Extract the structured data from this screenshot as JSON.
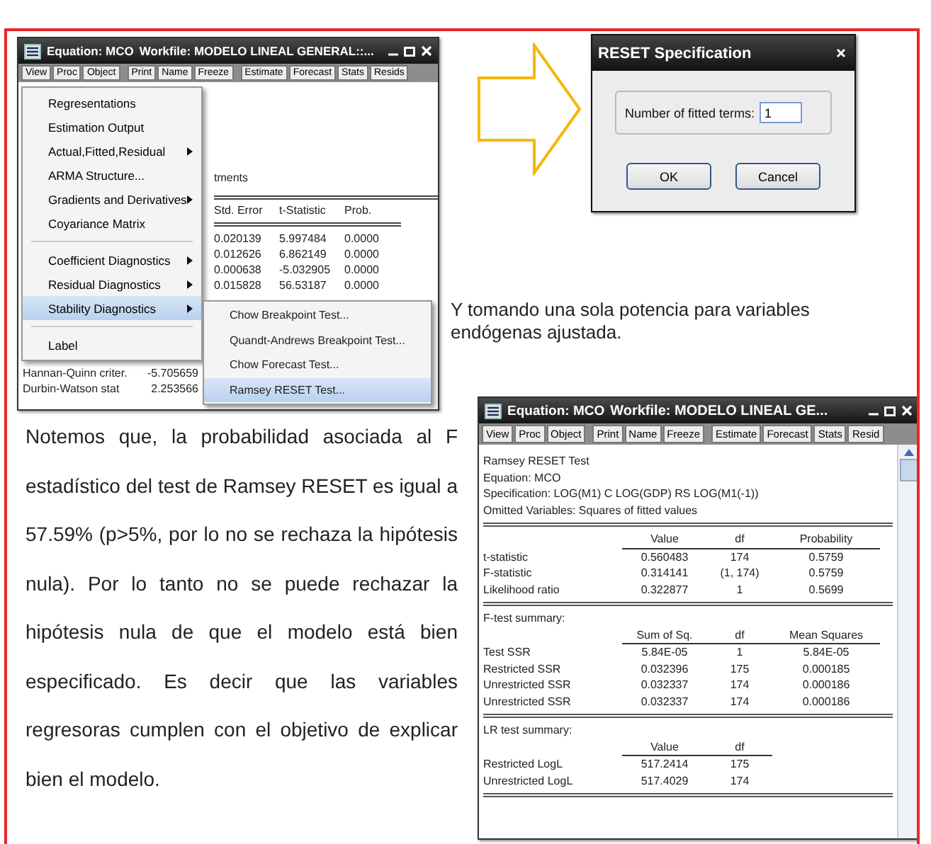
{
  "equation_window": {
    "title": "Equation: MCO",
    "workfile": "Workfile: MODELO LINEAL GENERAL::...",
    "toolbar": [
      "View",
      "Proc",
      "Object",
      "Print",
      "Name",
      "Freeze",
      "Estimate",
      "Forecast",
      "Stats",
      "Resids"
    ],
    "partial_label": "tments",
    "columns": [
      "Std. Error",
      "t-Statistic",
      "Prob."
    ],
    "rows": [
      [
        "0.020139",
        "5.997484",
        "0.0000"
      ],
      [
        "0.012626",
        "6.862149",
        "0.0000"
      ],
      [
        "0.000638",
        "-5.032905",
        "0.0000"
      ],
      [
        "0.015828",
        "56.53187",
        "0.0000"
      ]
    ],
    "stats": [
      {
        "label": "Hannan-Quinn criter.",
        "value": "-5.705659"
      },
      {
        "label": "Durbin-Watson stat",
        "value": "2.253566"
      }
    ],
    "menu": [
      {
        "kind": "item",
        "label": "Regresentations",
        "submenu": false,
        "selected": false
      },
      {
        "kind": "item",
        "label": "Estimation Output",
        "submenu": false,
        "selected": false
      },
      {
        "kind": "item",
        "label": "Actual,Fitted,Residual",
        "submenu": true,
        "selected": false
      },
      {
        "kind": "item",
        "label": "ARMA Structure...",
        "submenu": false,
        "selected": false
      },
      {
        "kind": "item",
        "label": "Gradients and Derivatives",
        "submenu": true,
        "selected": false
      },
      {
        "kind": "item",
        "label": "Coyariance Matrix",
        "submenu": false,
        "selected": false
      },
      {
        "kind": "separator"
      },
      {
        "kind": "item",
        "label": "Coefficient Diagnostics",
        "submenu": true,
        "selected": false
      },
      {
        "kind": "item",
        "label": "Residual Diagnostics",
        "submenu": true,
        "selected": false
      },
      {
        "kind": "item",
        "label": "Stability Diagnostics",
        "submenu": true,
        "selected": true
      },
      {
        "kind": "separator"
      },
      {
        "kind": "item",
        "label": "Label",
        "submenu": false,
        "selected": false
      }
    ],
    "submenu": [
      {
        "label": "Chow Breakpoint Test...",
        "selected": false
      },
      {
        "label": "Quandt-Andrews Breakpoint Test...",
        "selected": false
      },
      {
        "label": "Chow Forecast Test...",
        "selected": false
      },
      {
        "label": "Ramsey RESET Test...",
        "selected": true
      }
    ]
  },
  "dialog": {
    "title": "RESET Specification",
    "field_label": "Number of fitted terms:",
    "field_value": "1",
    "buttons": [
      "OK",
      "Cancel"
    ]
  },
  "caption": "Y tomando una sola potencia para variables endógenas ajustada.",
  "paragraph": "Notemos que, la probabilidad asociada al F estadístico del test de Ramsey RESET es igual a 57.59% (p>5%, por lo no se rechaza la hipótesis nula). Por lo tanto no se puede rechazar la hipótesis nula de que el modelo está bien especificado. Es decir que las variables regresoras cumplen con el objetivo de explicar bien el modelo.",
  "result_window": {
    "title": "Equation: MCO",
    "workfile": "Workfile: MODELO LINEAL GE...",
    "toolbar": [
      "View",
      "Proc",
      "Object",
      "Print",
      "Name",
      "Freeze",
      "Estimate",
      "Forecast",
      "Stats",
      "Resid"
    ],
    "header": [
      "Ramsey RESET Test",
      "Equation: MCO",
      "Specification: LOG(M1) C LOG(GDP) RS LOG(M1(-1))",
      "Omitted Variables: Squares of fitted values"
    ],
    "sections": [
      {
        "columns": [
          "Value",
          "df",
          "Probability"
        ],
        "rows": [
          {
            "label": "t-statistic",
            "cells": [
              "0.560483",
              "174",
              "0.5759"
            ]
          },
          {
            "label": "F-statistic",
            "cells": [
              "0.314141",
              "(1, 174)",
              "0.5759"
            ]
          },
          {
            "label": "Likelihood ratio",
            "cells": [
              "0.322877",
              "1",
              "0.5699"
            ]
          }
        ]
      },
      {
        "title": "F-test summary:",
        "columns": [
          "Sum of Sq.",
          "df",
          "Mean Squares"
        ],
        "rows": [
          {
            "label": "Test SSR",
            "cells": [
              "5.84E-05",
              "1",
              "5.84E-05"
            ]
          },
          {
            "label": "Restricted SSR",
            "cells": [
              "0.032396",
              "175",
              "0.000185"
            ]
          },
          {
            "label": "Unrestricted SSR",
            "cells": [
              "0.032337",
              "174",
              "0.000186"
            ]
          },
          {
            "label": "Unrestricted SSR",
            "cells": [
              "0.032337",
              "174",
              "0.000186"
            ]
          }
        ]
      },
      {
        "title": "LR test summary:",
        "columns": [
          "Value",
          "df"
        ],
        "rows": [
          {
            "label": "Restricted LogL",
            "cells": [
              "517.2414",
              "175"
            ]
          },
          {
            "label": "Unrestricted LogL",
            "cells": [
              "517.4029",
              "174"
            ]
          }
        ]
      }
    ]
  }
}
